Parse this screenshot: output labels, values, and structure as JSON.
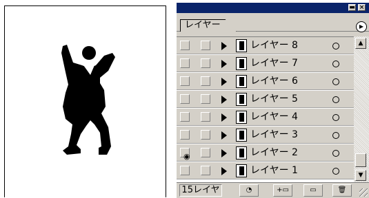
{
  "panel": {
    "tab_label": "レイヤー",
    "layer_count_label": "15レイヤ"
  },
  "layers": [
    {
      "name": "レイヤー 8",
      "visible": false
    },
    {
      "name": "レイヤー 7",
      "visible": false
    },
    {
      "name": "レイヤー 6",
      "visible": false
    },
    {
      "name": "レイヤー 5",
      "visible": false
    },
    {
      "name": "レイヤー 4",
      "visible": false
    },
    {
      "name": "レイヤー 3",
      "visible": false
    },
    {
      "name": "レイヤー 2",
      "visible": true
    },
    {
      "name": "レイヤー 1",
      "visible": false
    }
  ],
  "icons": {
    "minimize": "minimize-icon",
    "close": "close-icon",
    "panel_menu": "panel-menu-icon",
    "visibility": "eye-icon",
    "expand": "expand-triangle-icon",
    "new_layer": "new-layer-icon",
    "delete_layer": "trash-icon",
    "onion": "onion-skin-icon",
    "new_folder": "new-folder-icon"
  },
  "colors": {
    "titlebar": "#0a246a",
    "panel_face": "#d4d0c8",
    "silhouette": "#000000"
  }
}
